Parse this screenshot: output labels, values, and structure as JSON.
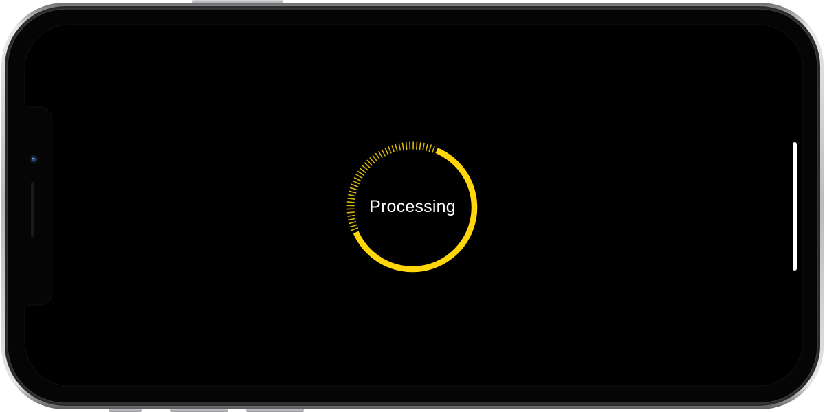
{
  "status": {
    "label": "Processing",
    "progress": 0.62
  },
  "colors": {
    "accent": "#FFD60A",
    "screen": "#000000",
    "text": "#FFFFFF",
    "home_indicator": "#FFFFFF"
  },
  "icons": {
    "camera": "front-camera-icon",
    "speaker": "earpiece-speaker-icon"
  }
}
